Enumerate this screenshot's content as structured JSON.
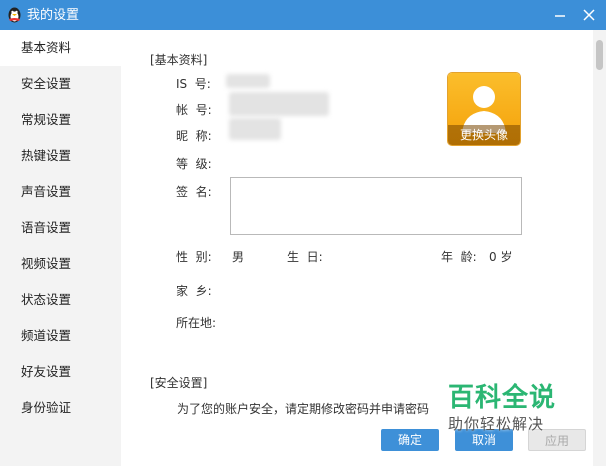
{
  "window": {
    "title": "我的设置",
    "icon": "qq-penguin-icon"
  },
  "sidebar": {
    "items": [
      {
        "label": "基本资料",
        "active": true
      },
      {
        "label": "安全设置"
      },
      {
        "label": "常规设置"
      },
      {
        "label": "热键设置"
      },
      {
        "label": "声音设置"
      },
      {
        "label": "语音设置"
      },
      {
        "label": "视频设置"
      },
      {
        "label": "状态设置"
      },
      {
        "label": "频道设置"
      },
      {
        "label": "好友设置"
      },
      {
        "label": "身份验证"
      }
    ]
  },
  "profile": {
    "section_title": "[基本资料]",
    "fields": {
      "is_label": "IS  号:",
      "account_label": "帐  号:",
      "nickname_label": "昵  称:",
      "level_label": "等  级:",
      "signature_label": "签  名:",
      "gender_label": "性  别:",
      "gender_value": "男",
      "birthday_label": "生  日:",
      "age_label": "年  龄:",
      "age_value": "0 岁",
      "hometown_label": "家  乡:",
      "location_label": "所在地:"
    },
    "avatar_button_label": "更换头像"
  },
  "security": {
    "section_title": "[安全设置]",
    "tip": "为了您的账户安全，请定期修改密码并申请密码"
  },
  "footer": {
    "ok_label": "确定",
    "cancel_label": "取消",
    "apply_label": "应用"
  },
  "watermark": {
    "title": "百科全说",
    "subtitle": "助你轻松解决"
  },
  "colors": {
    "titlebar": "#3c8fd8",
    "sidebar": "#f3f3f3",
    "primary_button": "#3e90d8",
    "avatar": "#f4a10a",
    "watermark": "#2bb673"
  }
}
